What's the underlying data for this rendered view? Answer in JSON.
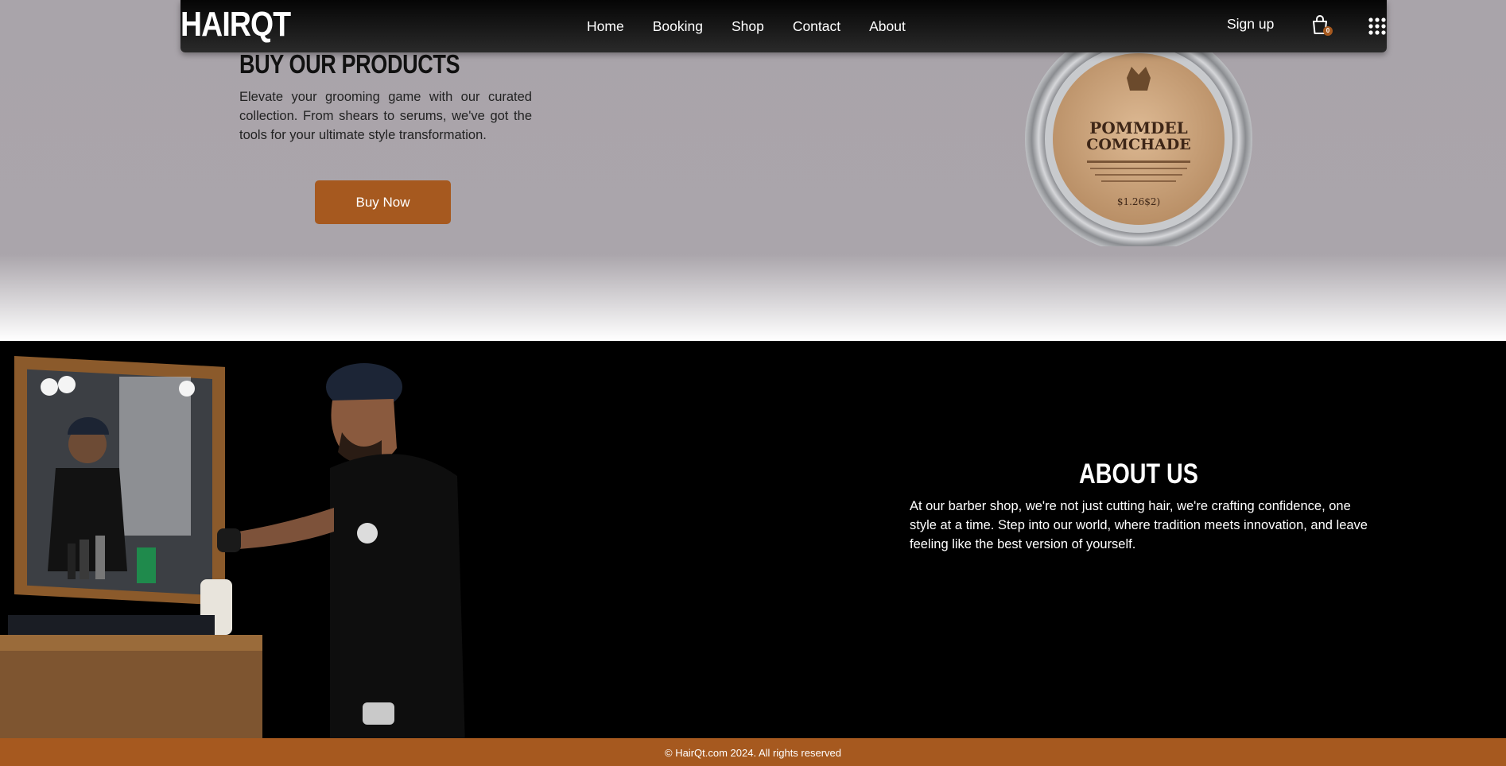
{
  "brand": {
    "logo": "HAIRQT",
    "accent_color": "#a6591f"
  },
  "nav": {
    "links": [
      "Home",
      "Booking",
      "Shop",
      "Contact",
      "About"
    ],
    "signup_label": "Sign up",
    "cart_count": "0",
    "cart_icon": "shopping-bag-icon",
    "menu_icon": "grid-menu-icon"
  },
  "hero": {
    "title": "BUY OUR PRODUCTS",
    "text": "Elevate your grooming game with our curated collection. From shears to serums, we've got the tools for your ultimate style transformation.",
    "button_label": "Buy Now",
    "product_label_line1": "POMMDEL",
    "product_label_line2": "COMCHADE",
    "product_price": "$1.26$2)"
  },
  "about": {
    "title": "ABOUT US",
    "text": "At our barber shop, we're not just cutting hair, we're crafting confidence, one style at a time. Step into our world, where tradition meets innovation, and leave feeling like the best version of yourself."
  },
  "footer": {
    "text": "© HairQt.com 2024. All rights reserved"
  }
}
